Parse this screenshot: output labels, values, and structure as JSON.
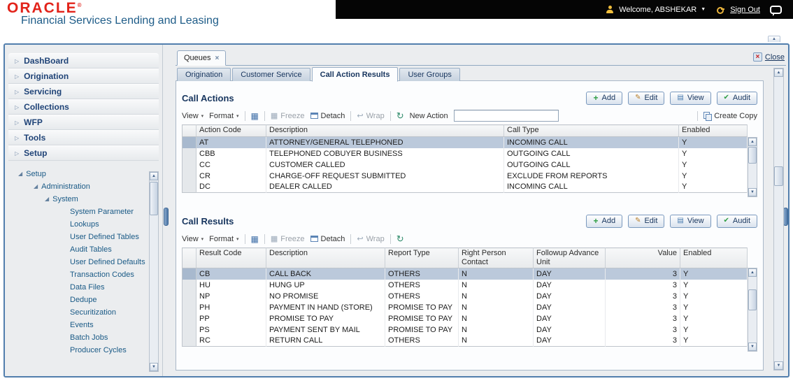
{
  "header": {
    "logo": "ORACLE",
    "logo_mark": "®",
    "subtitle": "Financial Services Lending and Leasing",
    "welcome": "Welcome, ABSHEKAR",
    "sign_out": "Sign Out"
  },
  "icons": {
    "add": "+",
    "edit": "✎",
    "view": "▤",
    "audit": "✔",
    "dropdown_caret": "▾",
    "menu_arrow": "▷",
    "tree_expanded": "◢",
    "export": "▦",
    "freeze": "▦",
    "wrap": "↩",
    "refresh": "↻",
    "scroll_up": "▲",
    "scroll_down": "▼",
    "close_x": "×",
    "tab_close": "×",
    "welcome_caret": "▼",
    "collapse_up": "▲"
  },
  "sidebar": {
    "menu": [
      "DashBoard",
      "Origination",
      "Servicing",
      "Collections",
      "WFP",
      "Tools",
      "Setup"
    ],
    "tree": [
      {
        "label": "Setup",
        "level": 0,
        "expanded": true
      },
      {
        "label": "Administration",
        "level": 1,
        "expanded": true
      },
      {
        "label": "System",
        "level": 2,
        "expanded": true
      },
      {
        "label": "System Parameter",
        "level": 3
      },
      {
        "label": "Lookups",
        "level": 3
      },
      {
        "label": "User Defined Tables",
        "level": 3
      },
      {
        "label": "Audit Tables",
        "level": 3
      },
      {
        "label": "User Defined Defaults",
        "level": 3
      },
      {
        "label": "Transaction Codes",
        "level": 3
      },
      {
        "label": "Data Files",
        "level": 3
      },
      {
        "label": "Dedupe",
        "level": 3
      },
      {
        "label": "Securitization",
        "level": 3
      },
      {
        "label": "Events",
        "level": 3
      },
      {
        "label": "Batch Jobs",
        "level": 3
      },
      {
        "label": "Producer Cycles",
        "level": 3
      }
    ]
  },
  "window": {
    "tab_label": "Queues",
    "close_label": "Close"
  },
  "subtabs": [
    {
      "label": "Origination",
      "active": false
    },
    {
      "label": "Customer Service",
      "active": false
    },
    {
      "label": "Call Action Results",
      "active": true
    },
    {
      "label": "User Groups",
      "active": false
    }
  ],
  "call_actions": {
    "title": "Call Actions",
    "buttons": {
      "add": "Add",
      "edit": "Edit",
      "view": "View",
      "audit": "Audit"
    },
    "toolbar": {
      "view": "View",
      "format": "Format",
      "freeze": "Freeze",
      "detach": "Detach",
      "wrap": "Wrap",
      "new_action_label": "New Action",
      "new_action_value": "",
      "create_copy": "Create Copy"
    },
    "columns": [
      "Action Code",
      "Description",
      "Call Type",
      "Enabled"
    ],
    "rows": [
      [
        "AT",
        "ATTORNEY/GENERAL TELEPHONED",
        "INCOMING CALL",
        "Y"
      ],
      [
        "CBB",
        "TELEPHONED COBUYER BUSINESS",
        "OUTGOING CALL",
        "Y"
      ],
      [
        "CC",
        "CUSTOMER CALLED",
        "OUTGOING CALL",
        "Y"
      ],
      [
        "CR",
        "CHARGE-OFF REQUEST SUBMITTED",
        "EXCLUDE FROM REPORTS",
        "Y"
      ],
      [
        "DC",
        "DEALER CALLED",
        "INCOMING CALL",
        "Y"
      ]
    ],
    "selected_row": 0
  },
  "call_results": {
    "title": "Call Results",
    "buttons": {
      "add": "Add",
      "edit": "Edit",
      "view": "View",
      "audit": "Audit"
    },
    "toolbar": {
      "view": "View",
      "format": "Format",
      "freeze": "Freeze",
      "detach": "Detach",
      "wrap": "Wrap"
    },
    "columns": [
      "Result Code",
      "Description",
      "Report Type",
      "Right Person Contact",
      "Followup Advance Unit",
      "Value",
      "Enabled"
    ],
    "rows": [
      [
        "CB",
        "CALL BACK",
        "OTHERS",
        "N",
        "DAY",
        "3",
        "Y"
      ],
      [
        "HU",
        "HUNG UP",
        "OTHERS",
        "N",
        "DAY",
        "3",
        "Y"
      ],
      [
        "NP",
        "NO PROMISE",
        "OTHERS",
        "N",
        "DAY",
        "3",
        "Y"
      ],
      [
        "PH",
        "PAYMENT IN HAND (STORE)",
        "PROMISE TO PAY",
        "N",
        "DAY",
        "3",
        "Y"
      ],
      [
        "PP",
        "PROMISE TO PAY",
        "PROMISE TO PAY",
        "N",
        "DAY",
        "3",
        "Y"
      ],
      [
        "PS",
        "PAYMENT SENT BY MAIL",
        "PROMISE TO PAY",
        "N",
        "DAY",
        "3",
        "Y"
      ],
      [
        "RC",
        "RETURN CALL",
        "OTHERS",
        "N",
        "DAY",
        "3",
        "Y"
      ]
    ],
    "selected_row": 0
  }
}
